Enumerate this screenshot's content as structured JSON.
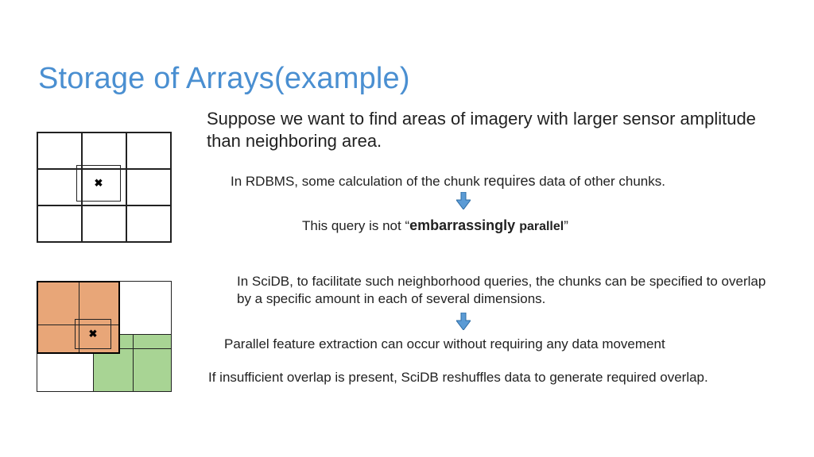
{
  "title": "Storage of Arrays(example)",
  "intro": "Suppose we want to find areas of imagery with larger sensor amplitude than neighboring area.",
  "rdbms_line_pre": "In RDBMS, some calculation of the chunk ",
  "rdbms_requires": "requires",
  "rdbms_line_post": " data of other chunks.",
  "not_parallel_pre": "This query is not “",
  "not_parallel_emb": "embarrassingly ",
  "not_parallel_par": "parallel",
  "not_parallel_post": "”",
  "scidb_line": "In SciDB,  to facilitate such neighborhood queries, the chunks can be specified to overlap by a specific amount in each of several dimensions.",
  "parallel_line": "Parallel feature extraction can occur without requiring any data movement",
  "reshuffle_line": "If insufficient overlap is present, SciDB reshuffles data to generate required overlap.",
  "cross_glyph": "✖",
  "arrow_color": "#4a8fd1"
}
